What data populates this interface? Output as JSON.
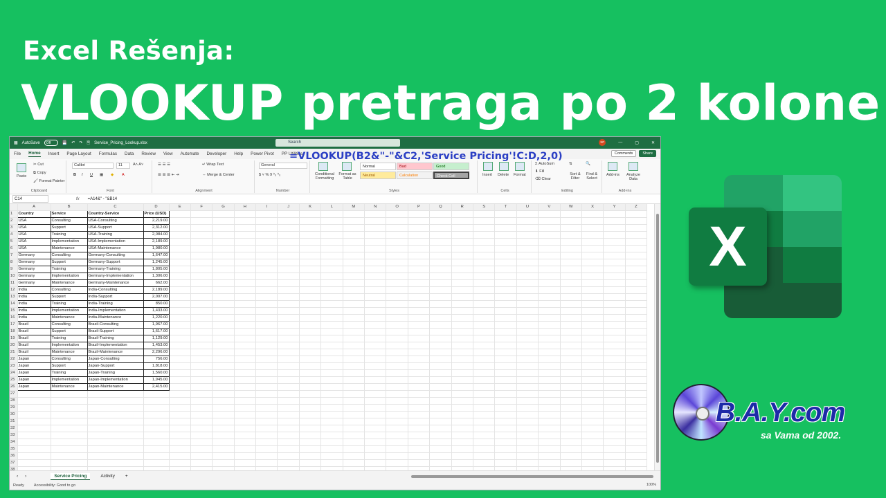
{
  "headline": {
    "line1": "Excel Rešenja:",
    "line2": "VLOOKUP pretraga po 2 kolone!"
  },
  "excel": {
    "titlebar": {
      "autosave": "AutoSave",
      "autosave_state": "Off",
      "filename": "Service_Pricing_Lookup.xlsx",
      "search_placeholder": "Search",
      "user_initials": "SP"
    },
    "menu": [
      "File",
      "Home",
      "Insert",
      "Page Layout",
      "Formulas",
      "Data",
      "Review",
      "View",
      "Automate",
      "Developer",
      "Help",
      "Power Pivot",
      "PP Utilities"
    ],
    "active_menu": "Home",
    "comments_label": "Comments",
    "share_label": "Share",
    "ribbon": {
      "clipboard": {
        "paste": "Paste",
        "cut": "Cut",
        "copy": "Copy",
        "format_painter": "Format Painter",
        "label": "Clipboard"
      },
      "font": {
        "name": "Calibri",
        "size": "11",
        "label": "Font"
      },
      "alignment": {
        "wrap": "Wrap Text",
        "merge": "Merge & Center",
        "label": "Alignment"
      },
      "number": {
        "format": "General",
        "label": "Number"
      },
      "styles": {
        "conditional": "Conditional Formatting",
        "format_table": "Format as Table",
        "normal": "Normal",
        "bad": "Bad",
        "good": "Good",
        "neutral": "Neutral",
        "calculation": "Calculation",
        "check_cell": "Check Cell",
        "label": "Styles"
      },
      "cells": {
        "insert": "Insert",
        "delete": "Delete",
        "format": "Format",
        "label": "Cells"
      },
      "editing": {
        "autosum": "AutoSum",
        "fill": "Fill",
        "clear": "Clear",
        "sort": "Sort & Filter",
        "find": "Find & Select",
        "label": "Editing"
      },
      "addins": {
        "addins": "Add-ins",
        "analyze": "Analyze Data",
        "label": "Add-ins"
      }
    },
    "formula_bar": {
      "name_box": "C14",
      "fx": "fx",
      "formula": "=A14&\" - \"&B14"
    },
    "columns": [
      "A",
      "B",
      "C",
      "D",
      "E",
      "F",
      "G",
      "H",
      "I",
      "J",
      "K",
      "L",
      "M",
      "N",
      "O",
      "P",
      "Q",
      "R",
      "S",
      "T",
      "U",
      "V",
      "W",
      "X",
      "Y",
      "Z"
    ],
    "headers": [
      "Country",
      "Service",
      "Country-Service",
      "Price (USD)"
    ],
    "rows": [
      [
        "USA",
        "Consulting",
        "USA-Consulting",
        "2,219.00"
      ],
      [
        "USA",
        "Support",
        "USA-Support",
        "2,312.00"
      ],
      [
        "USA",
        "Training",
        "USA-Training",
        "2,084.00"
      ],
      [
        "USA",
        "Implementation",
        "USA-Implementation",
        "2,189.00"
      ],
      [
        "USA",
        "Maintenance",
        "USA-Maintenance",
        "1,980.00"
      ],
      [
        "Germany",
        "Consulting",
        "Germany-Consulting",
        "1,647.00"
      ],
      [
        "Germany",
        "Support",
        "Germany-Support",
        "1,245.00"
      ],
      [
        "Germany",
        "Training",
        "Germany-Training",
        "1,805.00"
      ],
      [
        "Germany",
        "Implementation",
        "Germany-Implementation",
        "1,306.00"
      ],
      [
        "Germany",
        "Maintenance",
        "Germany-Maintenance",
        "662.00"
      ],
      [
        "India",
        "Consulting",
        "India-Consulting",
        "2,189.00"
      ],
      [
        "India",
        "Support",
        "India-Support",
        "2,007.00"
      ],
      [
        "India",
        "Training",
        "India-Training",
        "850.00"
      ],
      [
        "India",
        "Implementation",
        "India-Implementation",
        "1,433.00"
      ],
      [
        "India",
        "Maintenance",
        "India-Maintenance",
        "1,220.00"
      ],
      [
        "Brazil",
        "Consulting",
        "Brazil-Consulting",
        "1,967.00"
      ],
      [
        "Brazil",
        "Support",
        "Brazil-Support",
        "1,617.00"
      ],
      [
        "Brazil",
        "Training",
        "Brazil-Training",
        "1,129.00"
      ],
      [
        "Brazil",
        "Implementation",
        "Brazil-Implementation",
        "1,453.00"
      ],
      [
        "Brazil",
        "Maintenance",
        "Brazil-Maintenance",
        "2,296.00"
      ],
      [
        "Japan",
        "Consulting",
        "Japan-Consulting",
        "756.00"
      ],
      [
        "Japan",
        "Support",
        "Japan-Support",
        "1,818.00"
      ],
      [
        "Japan",
        "Training",
        "Japan-Training",
        "1,560.00"
      ],
      [
        "Japan",
        "Implementation",
        "Japan-Implementation",
        "1,945.00"
      ],
      [
        "Japan",
        "Maintenance",
        "Japan-Maintenance",
        "2,415.00"
      ]
    ],
    "total_rows": 38,
    "sheet_tabs": [
      "Service Pricing",
      "Activity"
    ],
    "active_tab": "Service Pricing",
    "status": {
      "ready": "Ready",
      "accessibility": "Accessibility: Good to go",
      "zoom": "100%"
    }
  },
  "overlay_formula": "=VLOOKUP(B2&\"-\"&C2,'Service Pricing'!C:D,2,0)",
  "excel_logo_letter": "X",
  "bay": {
    "name": "B.A.Y.com",
    "tagline": "sa Vama od 2002."
  },
  "colors": {
    "background": "#16c060",
    "excel_green": "#1e6e42",
    "formula_blue": "#2b3fc4",
    "bay_blue": "#1d2aa8"
  }
}
